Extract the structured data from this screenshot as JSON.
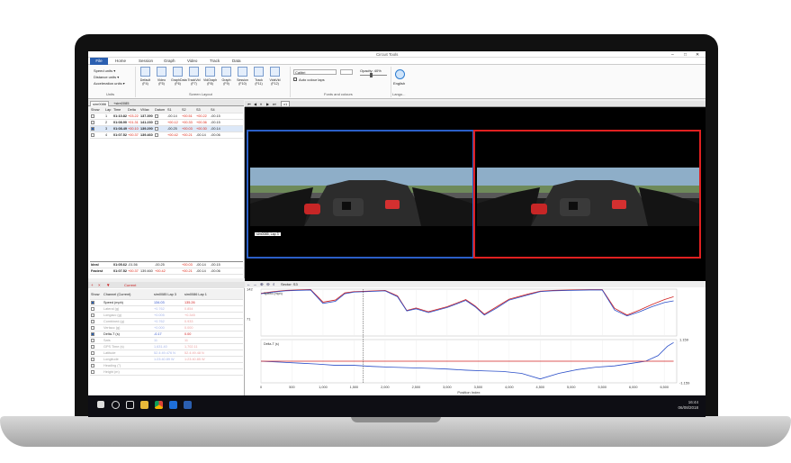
{
  "window": {
    "title": "Circuit Tools"
  },
  "menu": {
    "file": "File",
    "items": [
      "Home",
      "Session",
      "Graph",
      "Video",
      "Track",
      "Data"
    ]
  },
  "ribbon": {
    "units": {
      "speed": "Speed units ▾",
      "distance": "Distance units ▾",
      "acceleration": "Acceleration units ▾",
      "group": "Units"
    },
    "layout_buttons": [
      {
        "label": "Default",
        "key": "(F4)"
      },
      {
        "label": "Video",
        "key": "(F5)"
      },
      {
        "label": "GraphData",
        "key": "(F6)"
      },
      {
        "label": "TrackVid",
        "key": "(F7)"
      },
      {
        "label": "VidGraph",
        "key": "(F8)"
      },
      {
        "label": "Graph",
        "key": "(F9)"
      },
      {
        "label": "Session",
        "key": "(F10)"
      },
      {
        "label": "Track",
        "key": "(F11)"
      },
      {
        "label": "VidsVid",
        "key": "(F12)"
      }
    ],
    "layout_group": "Screen Layout",
    "font": "Calibri",
    "opacity": "Opacity: 40%",
    "auto_colour": "Auto colour laps",
    "fonts_group": "Fonts and colours",
    "language": "English",
    "language_group": "Langu..."
  },
  "tabs": [
    "sim0086",
    "+sim0085"
  ],
  "lap_table": {
    "headers": [
      "Show",
      "Lap",
      "Time",
      "Delta",
      "VMax",
      "Datum",
      "S1",
      "S2",
      "S3",
      "S4"
    ],
    "rows": [
      {
        "lap": "1",
        "time": "01:10.82",
        "delta": "+03.22",
        "vmax": "137.390",
        "s1": "-00.14",
        "s2": "+00.51",
        "s3": "+00.22",
        "s4": "-00.15",
        "checked": false
      },
      {
        "lap": "2",
        "time": "01:08.90",
        "delta": "+01.31",
        "vmax": "141.230",
        "s1": "+00.12",
        "s2": "+00.33",
        "s3": "+00.36",
        "s4": "-00.15",
        "checked": false
      },
      {
        "lap": "3",
        "time": "01:08.49",
        "delta": "+00.10",
        "vmax": "139.290",
        "s1": "-00.25",
        "s2": "+00.03",
        "s3": "+00.30",
        "s4": "-00.14",
        "checked": true
      },
      {
        "lap": "4",
        "time": "01:07.52",
        "delta": "+00.37",
        "vmax": "139.460",
        "s1": "+00.42",
        "s2": "+00.21",
        "s3": "-00.14",
        "s4": "-00.06",
        "checked": false
      }
    ]
  },
  "summary": {
    "rows": [
      {
        "label": "Ideal",
        "time": "01:05.62",
        "delta": "-01.56",
        "vmax": "",
        "s1": "-00.25",
        "s2": "+00.03",
        "s3": "-00.14",
        "s4": "-00.15"
      },
      {
        "label": "Fastest",
        "time": "01:07.52",
        "delta": "+00.37",
        "vmax": "139.460",
        "s1": "+00.42",
        "s2": "+00.21",
        "s3": "-00.14",
        "s4": "-00.06"
      }
    ]
  },
  "video": {
    "zoom": "x1",
    "caption": "sim0085, Lap 3"
  },
  "channel_table": {
    "toolbar_label": "Current",
    "headers": [
      "Show",
      "Channel (Current)",
      "sim0085 Lap 3",
      "sim0086 Lap 1"
    ],
    "rows": [
      {
        "name": "Speed (mph)",
        "a": "134.03",
        "b": "135.26",
        "checked": true,
        "active": true
      },
      {
        "name": "Lateral (g)",
        "a": "+0.762",
        "b": "0.854",
        "checked": false,
        "active": false
      },
      {
        "name": "Longacc (g)",
        "a": "+0.005",
        "b": "+0.345",
        "checked": false,
        "active": false
      },
      {
        "name": "Combined (g)",
        "a": "+0.762",
        "b": "0.933",
        "checked": false,
        "active": false
      },
      {
        "name": "Vertacc (g)",
        "a": "+0.000",
        "b": "0.000",
        "checked": false,
        "active": false
      },
      {
        "name": "Delta-T (s)",
        "a": "-0.17",
        "b": "0.00",
        "checked": true,
        "active": true
      },
      {
        "name": "Sats",
        "a": "11",
        "b": "11",
        "checked": false,
        "active": false
      },
      {
        "name": "GPS Time (s)",
        "a": "1,631.40",
        "b": "1,702.11",
        "checked": false,
        "active": false
      },
      {
        "name": "Latitude",
        "a": "52.4:49.476 N",
        "b": "52.4:49.48 N",
        "checked": false,
        "active": false
      },
      {
        "name": "Longitude",
        "a": "1:23:40.89 W",
        "b": "1:23:40.85 W",
        "checked": false,
        "active": false
      },
      {
        "name": "Heading (°)",
        "a": "",
        "b": "",
        "checked": false,
        "active": false
      },
      {
        "name": "Height (m)",
        "a": "",
        "b": "",
        "checked": false,
        "active": false
      }
    ]
  },
  "chart_toolbar": {
    "sector": "Sector: S3"
  },
  "chart_data": {
    "type": "line",
    "xlabel": "Position Index",
    "xticks": [
      0,
      500,
      1000,
      1500,
      2000,
      2500,
      3000,
      3500,
      4000,
      4500,
      5000,
      5500,
      6000,
      6500
    ],
    "xtick_labels": [
      "0",
      "500",
      "1,000",
      "1,500",
      "2,000",
      "2,500",
      "3,000",
      "3,500",
      "4,000",
      "4,500",
      "5,000",
      "5,500",
      "6,000",
      "6,500"
    ],
    "xlim": [
      0,
      6700
    ],
    "cursor_x": 1650,
    "panels": [
      {
        "name": "Speed (mph)",
        "yticks": [
          142,
          71
        ],
        "ylim": [
          30,
          142
        ],
        "x": [
          0,
          200,
          400,
          600,
          800,
          1000,
          1200,
          1350,
          1500,
          1700,
          2000,
          2200,
          2350,
          2500,
          2700,
          3000,
          3300,
          3450,
          3600,
          3800,
          4000,
          4300,
          4500,
          4700,
          5000,
          5300,
          5500,
          5700,
          5900,
          6100,
          6300,
          6500,
          6650
        ],
        "series": [
          {
            "name": "sim0085 Lap 3",
            "color": "#d02020",
            "values": [
              132,
              136,
              139,
              140,
              141,
              111,
              116,
              133,
              136,
              137,
              139,
              126,
              91,
              97,
              88,
              100,
              117,
              102,
              82,
              100,
              118,
              130,
              137,
              139,
              140,
              141,
              141,
              96,
              80,
              92,
              105,
              117,
              124
            ]
          },
          {
            "name": "sim0086 Lap 1",
            "color": "#2a4ec8",
            "values": [
              131,
              135,
              138,
              139,
              140,
              108,
              113,
              131,
              135,
              136,
              138,
              124,
              90,
              95,
              86,
              98,
              115,
              100,
              80,
              97,
              116,
              128,
              136,
              138,
              139,
              140,
              140,
              92,
              78,
              88,
              100,
              110,
              114
            ]
          }
        ]
      },
      {
        "name": "Delta-T (s)",
        "yticks": [
          1.159,
          -1.159
        ],
        "ytick_labels": [
          "1.159",
          "-1.159"
        ],
        "ylim": [
          -1.159,
          1.159
        ],
        "x": [
          0,
          300,
          600,
          900,
          1200,
          1500,
          1800,
          2100,
          2400,
          2700,
          3000,
          3300,
          3600,
          3900,
          4200,
          4500,
          4800,
          5100,
          5400,
          5700,
          6000,
          6200,
          6400,
          6550,
          6650
        ],
        "series": [
          {
            "name": "Delta-T",
            "color": "#2a4ec8",
            "values": [
              0.0,
              -0.05,
              -0.1,
              -0.15,
              -0.22,
              -0.22,
              -0.28,
              -0.32,
              -0.35,
              -0.38,
              -0.42,
              -0.48,
              -0.52,
              -0.55,
              -0.65,
              -0.95,
              -0.65,
              -0.45,
              -0.32,
              -0.25,
              -0.1,
              0.0,
              0.3,
              0.8,
              1.0
            ]
          },
          {
            "name": "Zero",
            "color": "#d02020",
            "values": [
              0,
              0,
              0,
              0,
              0,
              0,
              0,
              0,
              0,
              0,
              0,
              0,
              0,
              0,
              0,
              0,
              0,
              0,
              0,
              0,
              0,
              0,
              0,
              0,
              0
            ]
          }
        ]
      }
    ]
  },
  "taskbar": {
    "time": "16:44",
    "date": "06/08/2018"
  }
}
